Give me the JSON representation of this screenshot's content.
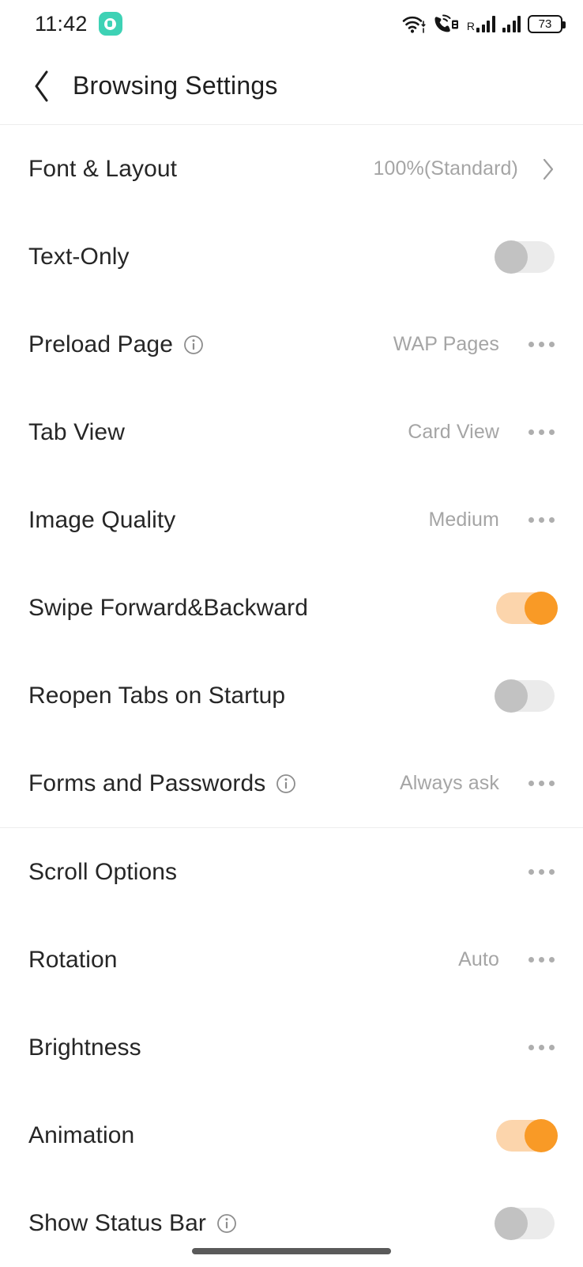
{
  "status_bar": {
    "time": "11:42",
    "app_badge_icon": "messaging-app-icon",
    "wifi_icon": "wifi-with-data-arrows-icon",
    "call_icon": "volte-call-icon",
    "roaming_label": "R",
    "signal_icon_1": "signal-bars-icon",
    "signal_icon_2": "signal-bars-icon",
    "battery_level": "73",
    "battery_icon": "battery-icon"
  },
  "header": {
    "back_icon": "back-chevron-icon",
    "title": "Browsing Settings"
  },
  "sections": [
    {
      "rows": [
        {
          "label": "Font & Layout",
          "info": false,
          "value": "100%(Standard)",
          "control": "chevron"
        },
        {
          "label": "Text-Only",
          "info": false,
          "value": "",
          "control": "toggle-off"
        },
        {
          "label": "Preload Page",
          "info": true,
          "value": "WAP Pages",
          "control": "dots"
        },
        {
          "label": "Tab View",
          "info": false,
          "value": "Card View",
          "control": "dots"
        },
        {
          "label": "Image Quality",
          "info": false,
          "value": "Medium",
          "control": "dots"
        },
        {
          "label": "Swipe Forward&Backward",
          "info": false,
          "value": "",
          "control": "toggle-on"
        },
        {
          "label": "Reopen Tabs on Startup",
          "info": false,
          "value": "",
          "control": "toggle-off"
        },
        {
          "label": "Forms and Passwords",
          "info": true,
          "value": "Always ask",
          "control": "dots"
        }
      ]
    },
    {
      "rows": [
        {
          "label": "Scroll Options",
          "info": false,
          "value": "",
          "control": "dots"
        },
        {
          "label": "Rotation",
          "info": false,
          "value": "Auto",
          "control": "dots"
        },
        {
          "label": "Brightness",
          "info": false,
          "value": "",
          "control": "dots"
        },
        {
          "label": "Animation",
          "info": false,
          "value": "",
          "control": "toggle-on"
        },
        {
          "label": "Show Status Bar",
          "info": true,
          "value": "",
          "control": "toggle-off"
        }
      ]
    }
  ],
  "colors": {
    "accent_on": "#f99a26",
    "accent_track": "#fcd5ac",
    "toggle_off_knob": "#c2c2c2",
    "toggle_off_track": "#ebebeb",
    "value_text": "#a5a5a5",
    "label_text": "#262626",
    "badge_teal": "#3ed2b5"
  },
  "home_indicator": "home-gesture-bar"
}
